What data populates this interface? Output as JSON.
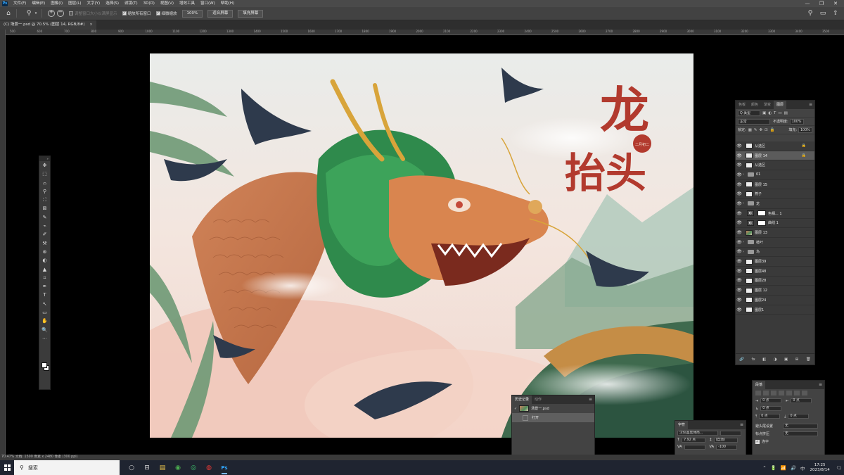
{
  "app": {
    "logo": "Ps",
    "menu": [
      "文件(F)",
      "编辑(E)",
      "图像(I)",
      "图层(L)",
      "文字(Y)",
      "选择(S)",
      "滤镜(T)",
      "3D(D)",
      "视图(V)",
      "增效工具",
      "窗口(W)",
      "帮助(H)"
    ],
    "window_controls": [
      "—",
      "❐",
      "✕"
    ]
  },
  "options": {
    "tool_icon": "magnifier-icon",
    "zoom_in": "+",
    "zoom_out": "−",
    "resize_windows": "调整窗口大小以满屏显示",
    "zoom_all": "缩放所有窗口",
    "scrubby_zoom": "细微缩放",
    "zoom_100": "100%",
    "fit_screen": "适合屏幕",
    "fill_screen": "填充屏幕"
  },
  "document": {
    "tab_title": "(C) 场景一.psd @ 70.5% (图层 14, RGB/8#)",
    "close": "×",
    "status": "70.47%   文档: 1500 像素 x 2480 像素 (300 ppi)"
  },
  "rulers": [
    "500",
    "600",
    "700",
    "800",
    "900",
    "1000",
    "1100",
    "1200",
    "1300",
    "1400",
    "1500",
    "1600",
    "1700",
    "1800",
    "1900",
    "2000",
    "2100",
    "2200",
    "2300",
    "2400",
    "2500",
    "2600",
    "2700",
    "2800",
    "2900",
    "3000",
    "3100",
    "3200",
    "3300",
    "3400",
    "3500"
  ],
  "artwork": {
    "title_line1": "龙",
    "title_line2": "抬头",
    "seal_text": "二月初二"
  },
  "tools": [
    "✥",
    "⬚",
    "⌓",
    "⚲",
    "⛶",
    "⊠",
    "✎",
    "⌁",
    "✐",
    "⚒",
    "⊛",
    "◐",
    "▲",
    "⌗",
    "✒",
    "T",
    "↖",
    "▭",
    "✋",
    "🔍",
    "⋯"
  ],
  "layers_panel": {
    "tabs": [
      "色板",
      "颜色",
      "渐变",
      "图层"
    ],
    "active_tab": "图层",
    "filter_label": "Q 类型",
    "blend_mode": "正常",
    "opacity_label": "不透明度:",
    "opacity_value": "100%",
    "lock_label": "锁定:",
    "fill_label": "填充:",
    "fill_value": "100%",
    "footer_icons": [
      "🔗",
      "fx",
      "◧",
      "◑",
      "▣",
      "⊞",
      "🗑"
    ],
    "layers": [
      {
        "name": "从选区",
        "type": "layer",
        "lock": true
      },
      {
        "name": "图层 14",
        "type": "layer",
        "selected": true,
        "lock": true
      },
      {
        "name": "从选区",
        "type": "layer"
      },
      {
        "name": "01",
        "type": "group"
      },
      {
        "name": "图层 15",
        "type": "layer"
      },
      {
        "name": "燕子",
        "type": "layer"
      },
      {
        "name": "龙",
        "type": "group"
      },
      {
        "name": "色相... 1",
        "type": "adjustment"
      },
      {
        "name": "曲线 1",
        "type": "adjustment"
      },
      {
        "name": "图层 13",
        "type": "art"
      },
      {
        "name": "枝叶",
        "type": "group"
      },
      {
        "name": "鸟",
        "type": "group"
      },
      {
        "name": "图层39",
        "type": "layer"
      },
      {
        "name": "图层48",
        "type": "layer"
      },
      {
        "name": "图层28",
        "type": "layer"
      },
      {
        "name": "图层 12",
        "type": "layer"
      },
      {
        "name": "图层24",
        "type": "layer"
      },
      {
        "name": "图层1",
        "type": "layer"
      }
    ]
  },
  "history_panel": {
    "tabs": [
      "历史记录",
      "动作"
    ],
    "snapshot": "场景一.psd",
    "step": "打开"
  },
  "character_panel": {
    "tab": "字符",
    "font": "汉仪晶黑体简...",
    "size": "7.92 点",
    "leading": "(自动)",
    "tracking": "-100"
  },
  "paragraph_panel": {
    "tab": "段落",
    "indent_left": "0 点",
    "indent_right": "0 点",
    "indent_first": "0 点",
    "space_before": "0 点",
    "space_after": "0 点",
    "kinsoku_label": "避头尾设置",
    "kinsoku_value": "无",
    "mojikumi_label": "标点挤压",
    "mojikumi_value": "无",
    "hyphenate": "连字"
  },
  "taskbar": {
    "search": "搜索",
    "apps": [
      "○",
      "⊟",
      "▤",
      "◉",
      "◎",
      "◍",
      "Ps"
    ],
    "time": "17:25",
    "date": "2023/8/14",
    "tray": [
      "⌃",
      "🔋",
      "📶",
      "🔊",
      "中",
      "🗨"
    ]
  }
}
